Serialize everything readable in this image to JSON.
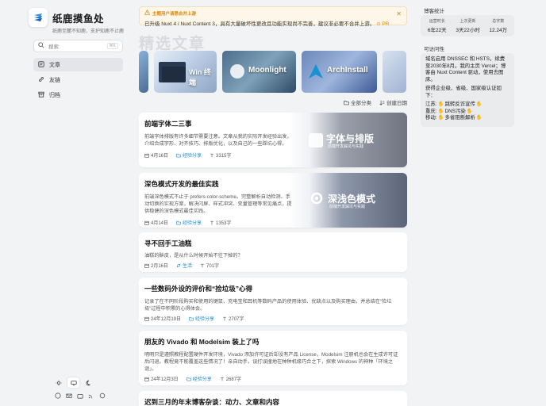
{
  "brand": {
    "title": "纸鹿摸鱼处",
    "subtitle": "纸鹿至麓不知鹿，支护知鹿不止鹿"
  },
  "search": {
    "placeholder": "搜索",
    "shortcut": "⌘K"
  },
  "nav": {
    "items": [
      {
        "label": "文章",
        "icon": "article-icon",
        "active": true
      },
      {
        "label": "友链",
        "icon": "link-icon",
        "active": false
      },
      {
        "label": "归档",
        "icon": "archive-icon",
        "active": false
      }
    ]
  },
  "notice": {
    "title": "主题用户请悉合并上游",
    "body": "已升级 Nuxt 4 / Nuxt Content 3，具有大量破坏性更改且功能实现尚不完善，建议非必要不合并上游。",
    "pr": "PR"
  },
  "featured": {
    "heading": "精选文章",
    "cards": [
      {
        "label": ""
      },
      {
        "label": "Win 终端"
      },
      {
        "label": "Moonlight"
      },
      {
        "label": "ArchInstall"
      },
      {
        "label": ""
      }
    ]
  },
  "filters": {
    "category": "全部分类",
    "sort": "创建日期"
  },
  "posts": [
    {
      "title": "前端字体二三事",
      "desc": "前端字体排版有许多细节需要注意。文章从我的实际开发经验出发，介绍合成字形、对齐技巧、排版优化，以及自己的一些踩坑心得。",
      "date": "4月16日",
      "category": "经验分享",
      "words": "3315字",
      "cover_title": "字体与排版",
      "cover_sub": "前端开发踩坑与实践"
    },
    {
      "title": "深色模式开发的最佳实践",
      "desc": "前端深色模式不止于 prefers-color-scheme。完整解析自动检测、手动切换的实现方案，解决闪屏、样式冲突、变量管理等常见痛点，提供稳健的深色模式最佳实践。",
      "date": "4月14日",
      "category": "经验分享",
      "words": "1353字",
      "cover_title": "深浅色模式",
      "cover_sub": "前端开发踩坑与实践"
    },
    {
      "title": "寻不回手工油糕",
      "desc": "油糕的酥皮，是从什么时候开始不往下掉的？",
      "date": "2月16日",
      "category": "生活",
      "words": "701字"
    },
    {
      "title": "一些数码外设的评价和“捡垃圾”心得",
      "desc": "记录了在不同阶段购买和使用的键鼠、充电宝和耳机等数码产品的使用体验、优缺点以及购买理由，并总结在“捡垃圾”过程中积累的心得体会。",
      "date": "24年12月19日",
      "category": "经验分享",
      "words": "2707字"
    },
    {
      "title": "朋友的 Vivado 和 Modelsim 装上了吗",
      "desc": "明明只是遵照教程配置硬件开发环境，Vivado 添加许可证后却没有产品 License，Modelsim 注册机也会在生成许可证后闪退。教程竟不能覆盖这些情况了！亲自动手，误打误撞地在种种机缘巧合之下，探索 Windows 的神种「环境之谜」。",
      "date": "24年12月3日",
      "category": "经验分享",
      "words": "2687字"
    },
    {
      "title": "迟到三月的年末博客杂谈：动力、文章和内容"
    }
  ],
  "right": {
    "stats_title": "博客统计",
    "stats": [
      {
        "label": "运营时长",
        "value": "6年22天"
      },
      {
        "label": "上次更新",
        "value": "3天22小时"
      },
      {
        "label": "总字数",
        "value": "12.24万"
      }
    ],
    "access_title": "可访问性",
    "access_p1": "域名启用 DNSSEC 和 HSTS，续费至2030年8月。我的主页 Vercel；博客由 Nuxt Content 驱动，使用去图床。",
    "access_p2": "获得企业级、省级、国家级认证如下：",
    "access_lines": [
      {
        "k": "江苏:",
        "v": "跳转反诈宣传"
      },
      {
        "k": "重庆:",
        "v": "DNS污染"
      },
      {
        "k": "移动:",
        "v": "多省阻断解析"
      }
    ]
  },
  "colors": {
    "accent": "#1e8ad6",
    "notice": "#d48a12",
    "bg": "#f2f3f5"
  }
}
